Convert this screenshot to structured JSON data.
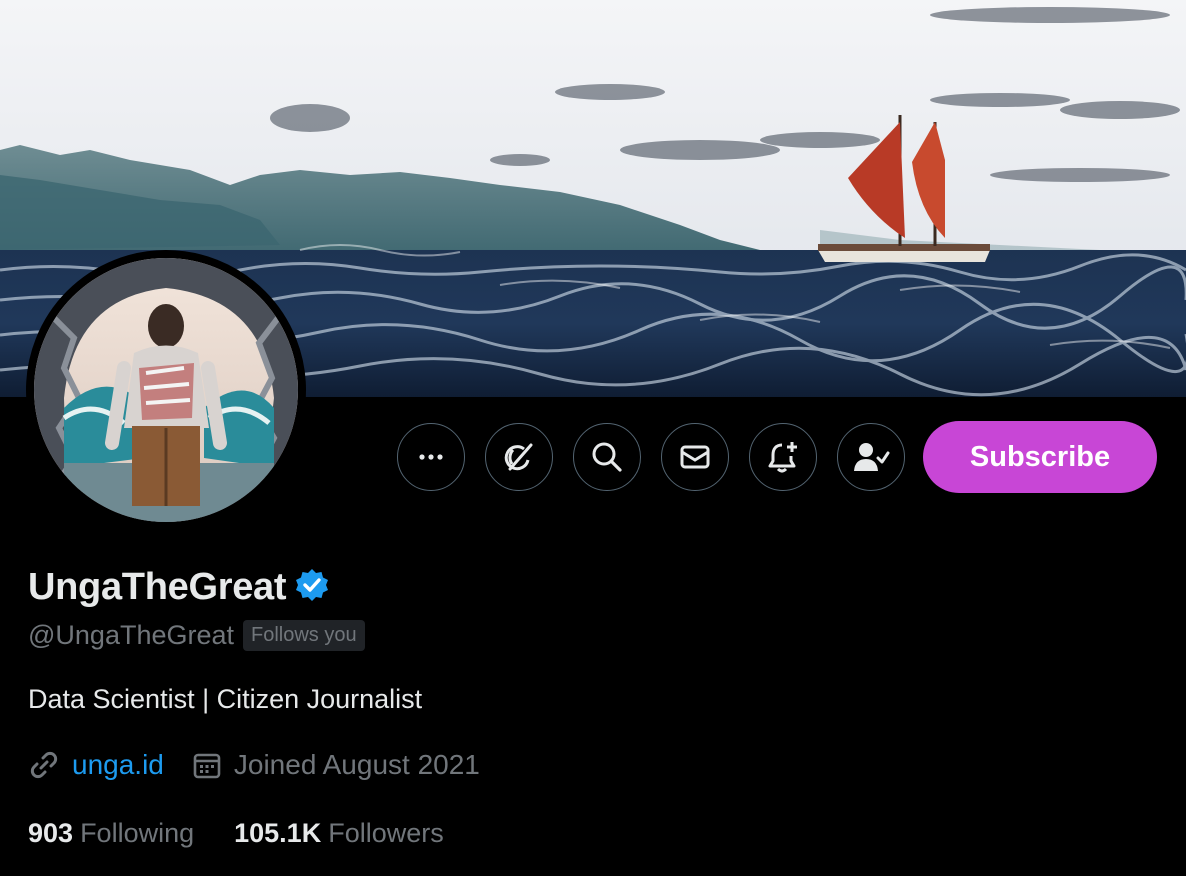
{
  "profile": {
    "display_name": "UngaTheGreat",
    "handle": "@UngaTheGreat",
    "follows_you": "Follows you",
    "bio": "Data Scientist | Citizen Journalist",
    "website": "unga.id",
    "joined": "Joined August 2021",
    "verified": true
  },
  "stats": {
    "following_count": "903",
    "following_label": "Following",
    "followers_count": "105.1K",
    "followers_label": "Followers"
  },
  "actions": {
    "subscribe_label": "Subscribe",
    "icons": [
      "more-icon",
      "grok-icon",
      "search-icon",
      "message-icon",
      "notification-bell-icon",
      "following-icon"
    ]
  },
  "colors": {
    "background": "#000000",
    "subscribe_button": "#c846d6",
    "link": "#1d9bf0",
    "verified_badge": "#1d9bf0",
    "secondary_text": "#71767b",
    "primary_text": "#e7e9ea"
  }
}
